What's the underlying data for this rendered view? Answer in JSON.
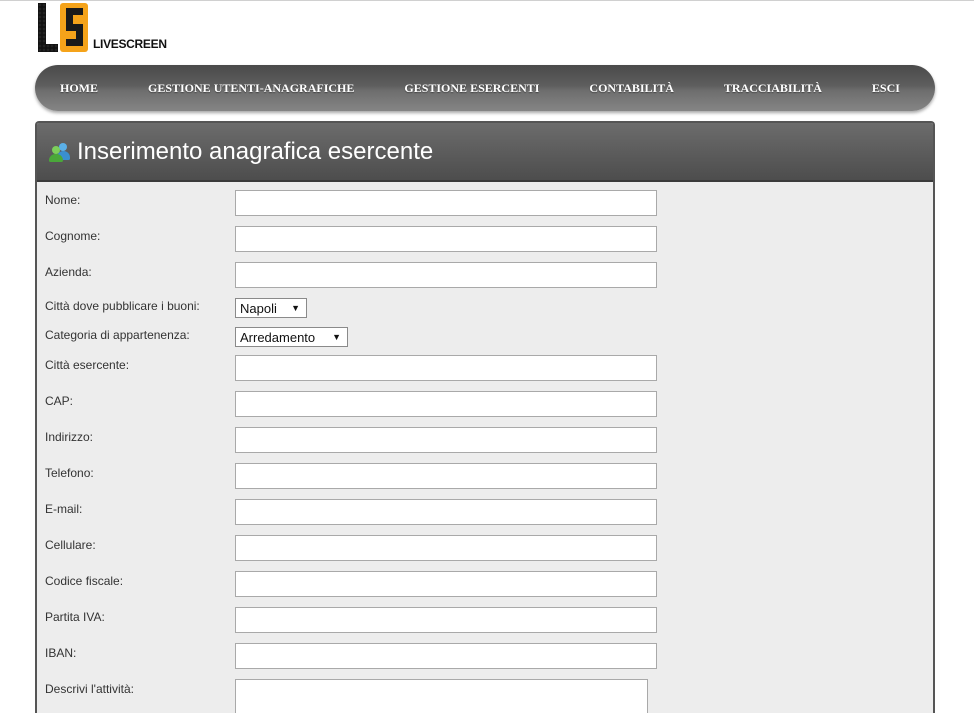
{
  "logo": {
    "text": "LIVESCREEN"
  },
  "nav": {
    "items": [
      "HOME",
      "GESTIONE UTENTI-ANAGRAFICHE",
      "GESTIONE ESERCENTI",
      "CONTABILITÀ",
      "TRACCIABILITÀ",
      "ESCI"
    ]
  },
  "panel": {
    "title": "Inserimento anagrafica esercente",
    "icon": "users-icon"
  },
  "form": {
    "nome": {
      "label": "Nome:",
      "value": ""
    },
    "cognome": {
      "label": "Cognome:",
      "value": ""
    },
    "azienda": {
      "label": "Azienda:",
      "value": ""
    },
    "citta_buoni": {
      "label": "Città dove pubblicare i buoni:",
      "selected": "Napoli"
    },
    "categoria": {
      "label": "Categoria di appartenenza:",
      "selected": "Arredamento"
    },
    "citta_esercente": {
      "label": "Città esercente:",
      "value": ""
    },
    "cap": {
      "label": "CAP:",
      "value": ""
    },
    "indirizzo": {
      "label": "Indirizzo:",
      "value": ""
    },
    "telefono": {
      "label": "Telefono:",
      "value": ""
    },
    "email": {
      "label": "E-mail:",
      "value": ""
    },
    "cellulare": {
      "label": "Cellulare:",
      "value": ""
    },
    "codice_fiscale": {
      "label": "Codice fiscale:",
      "value": ""
    },
    "partita_iva": {
      "label": "Partita IVA:",
      "value": ""
    },
    "iban": {
      "label": "IBAN:",
      "value": ""
    },
    "descrizione": {
      "label": "Descrivi l'attività:",
      "value": ""
    }
  },
  "colors": {
    "logo_accent": "#f5a31a",
    "nav_bg": "#5e5e5e",
    "panel_header": "#5a5a5a",
    "form_bg": "#ededed"
  }
}
